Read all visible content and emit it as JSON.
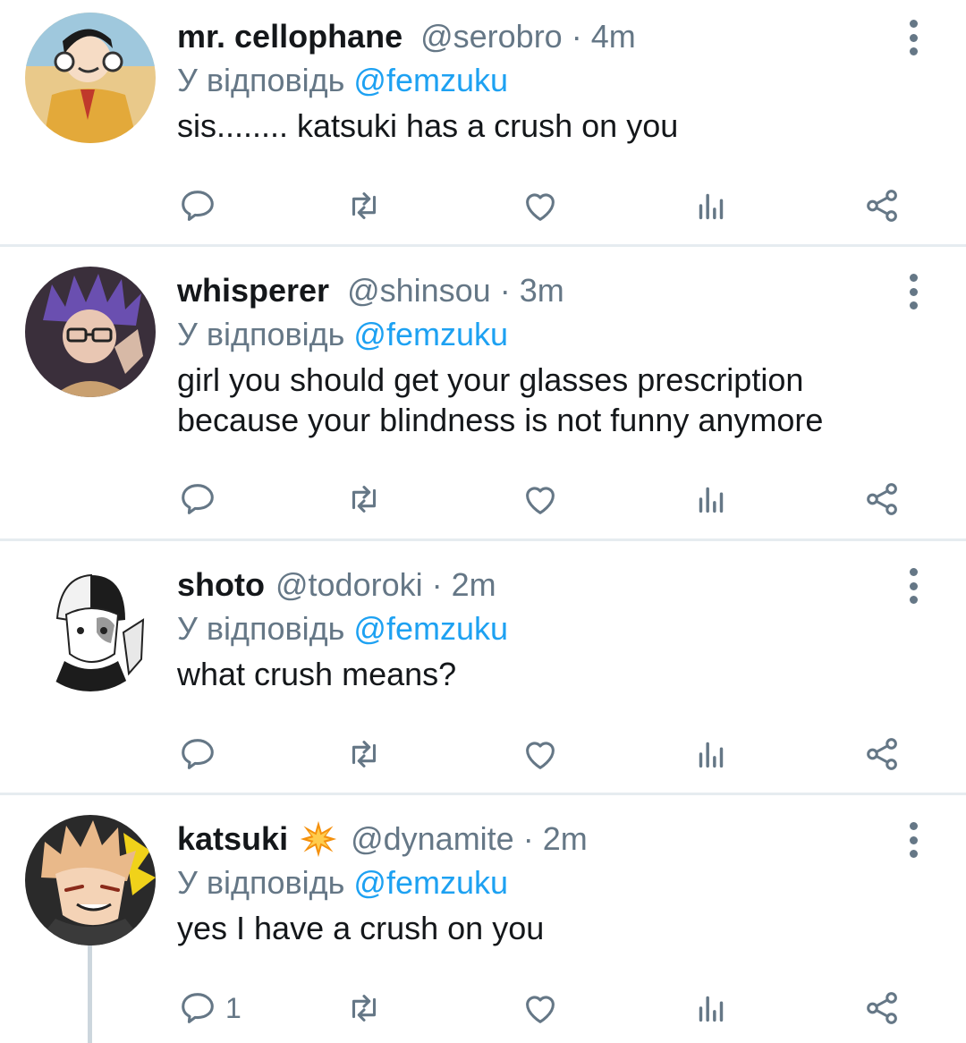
{
  "colors": {
    "accent": "#1da1f2",
    "secondary": "#657786",
    "divider": "#e6ecf0"
  },
  "reply_prefix": "У відповідь",
  "tweets": [
    {
      "name": "mr. cellophane",
      "handle": "@serobro",
      "time": "4m",
      "reply_to": "@femzuku",
      "text_lines": [
        "sis........ katsuki has a crush on you"
      ],
      "reply_count": ""
    },
    {
      "name": "whisperer",
      "handle": "@shinsou",
      "time": "3m",
      "reply_to": "@femzuku",
      "text_lines": [
        "girl you should get your glasses prescription",
        "because your blindness is not funny anymore"
      ],
      "reply_count": ""
    },
    {
      "name": "shoto",
      "handle": "@todoroki",
      "time": "2m",
      "reply_to": "@femzuku",
      "text_lines": [
        "what crush means?"
      ],
      "reply_count": ""
    },
    {
      "name": "katsuki",
      "name_emoji": "collision-emoji",
      "handle": "@dynamite",
      "time": "2m",
      "reply_to": "@femzuku",
      "text_lines": [
        "yes I have a crush on you"
      ],
      "reply_count": "1"
    }
  ],
  "icons": [
    "reply-icon",
    "retweet-icon",
    "like-icon",
    "analytics-icon",
    "share-icon",
    "more-options-icon"
  ]
}
